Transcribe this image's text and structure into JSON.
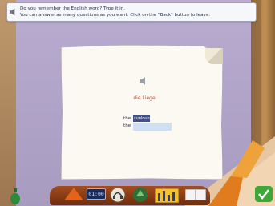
{
  "instructions": {
    "line1": "Do you remember the English word? Type it in.",
    "line2": "You can answer as many questions as you want. Click on the \"Back\" button to leave."
  },
  "card": {
    "german_word": "die Liege",
    "answer_article": "the",
    "answer_word": "sunlounger",
    "input_article": "the",
    "input_value": ""
  },
  "toolbar": {
    "clock_display": "01:00"
  },
  "colors": {
    "wall": "#b3a5c7",
    "paper": "#fbf9f1",
    "german_word": "#c8452d",
    "answer_highlight": "#3f4f90",
    "input_bg": "#cfe0f2",
    "toolbar": "#8a3a12",
    "ok_button": "#3fa63a"
  },
  "icons": [
    "speaker-icon",
    "bottle-icon",
    "arrow-icon",
    "clock-icon",
    "headphones-icon",
    "tree-icon",
    "bar-chart-icon",
    "book-icon",
    "checkmark-icon"
  ]
}
